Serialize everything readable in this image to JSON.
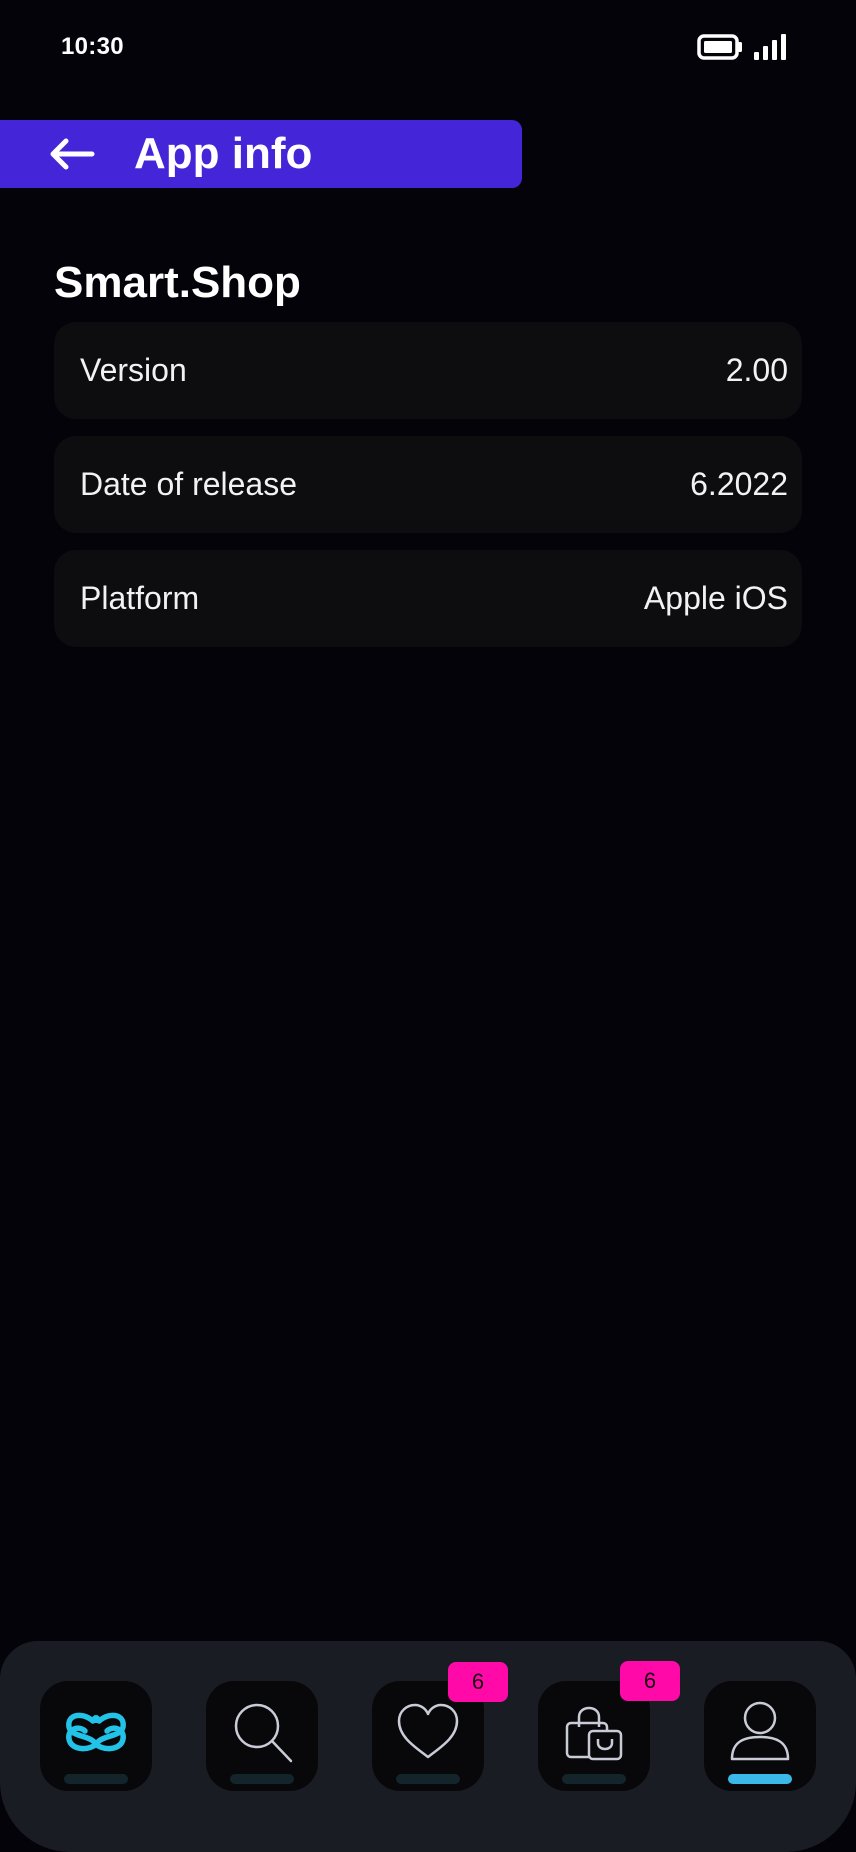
{
  "status_bar": {
    "time": "10:30"
  },
  "header": {
    "title": "App info"
  },
  "app": {
    "name": "Smart.Shop"
  },
  "info_rows": [
    {
      "label": "Version",
      "value": "2.00"
    },
    {
      "label": "Date of release",
      "value": "6.2022"
    },
    {
      "label": "Platform",
      "value": "Apple iOS"
    }
  ],
  "bottom_nav": {
    "items": [
      {
        "name": "home",
        "icon": "brand-logo-icon",
        "active": false
      },
      {
        "name": "search",
        "icon": "search-icon",
        "active": false
      },
      {
        "name": "favorites",
        "icon": "heart-icon",
        "active": false,
        "badge": "6"
      },
      {
        "name": "cart",
        "icon": "shopping-bag-icon",
        "active": false,
        "badge": "6"
      },
      {
        "name": "profile",
        "icon": "user-icon",
        "active": true
      }
    ]
  },
  "colors": {
    "background": "#04030a",
    "header_accent": "#4425d8",
    "card_background": "#0d0d0f",
    "nav_background": "#1a1c24",
    "badge": "#ff0aa8",
    "active_indicator": "#3ab9e8",
    "logo": "#22c3e6"
  }
}
